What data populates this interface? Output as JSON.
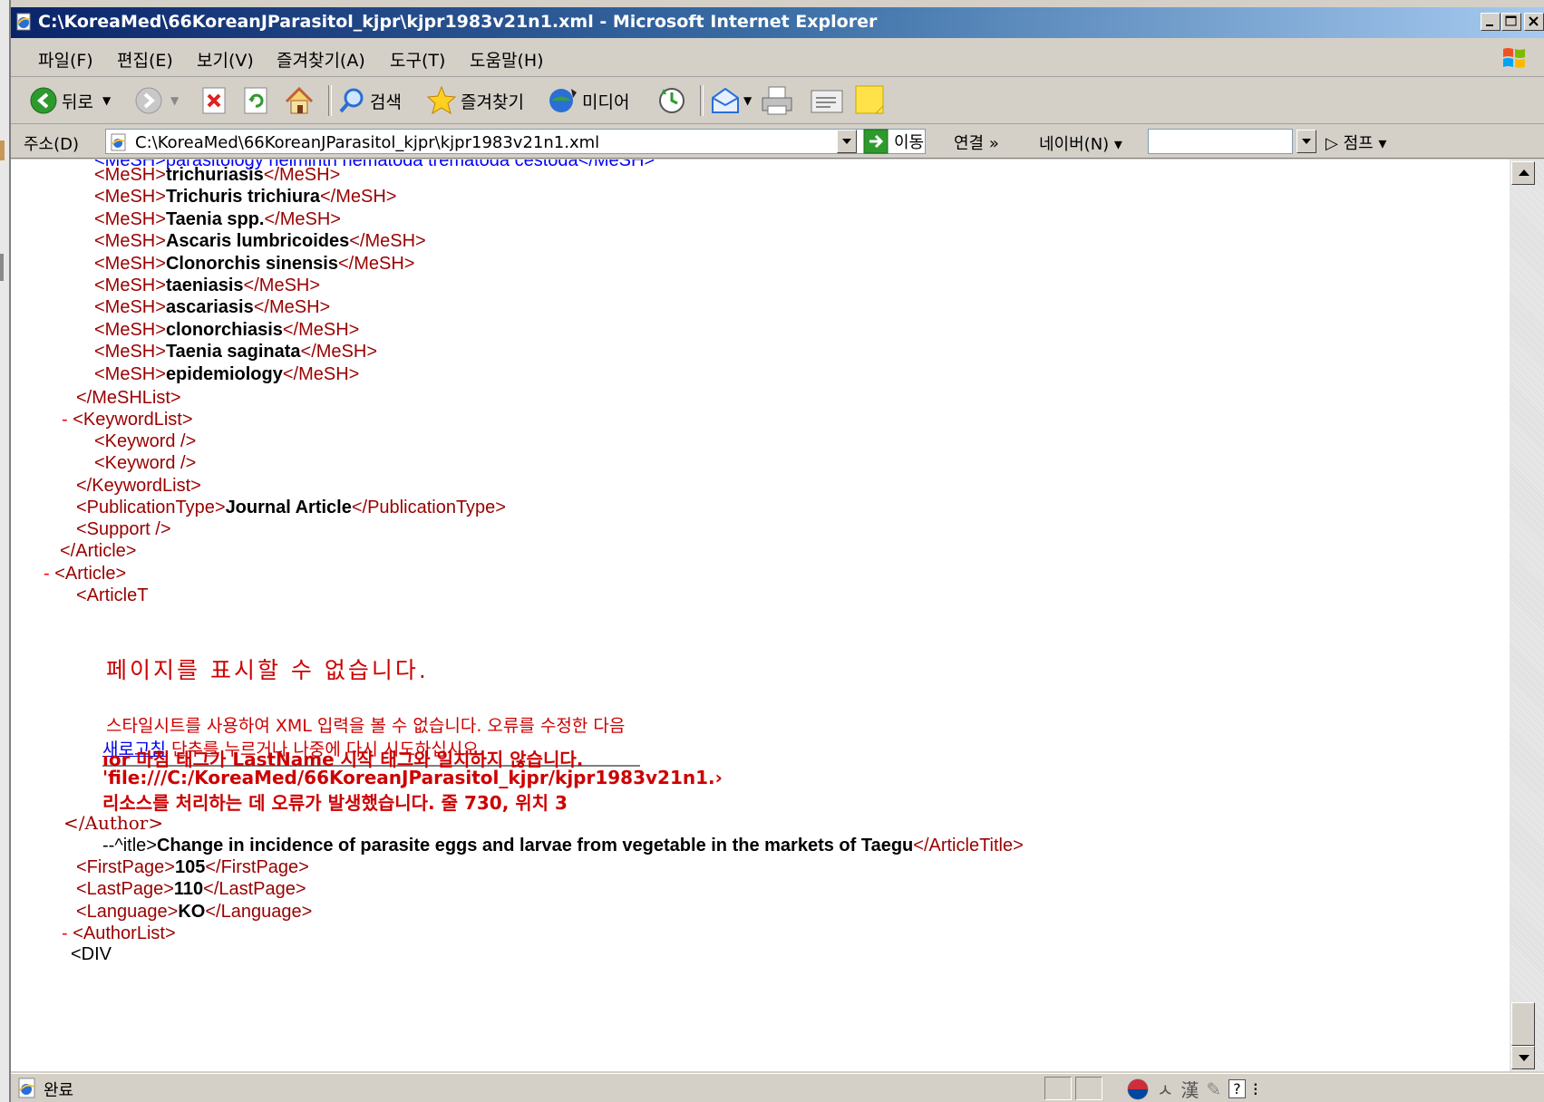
{
  "window": {
    "title": "C:\\KoreaMed\\66KoreanJParasitol_kjpr\\kjpr1983v21n1.xml - Microsoft Internet Explorer"
  },
  "menu": [
    "파일(F)",
    "편집(E)",
    "보기(V)",
    "즐겨찾기(A)",
    "도구(T)",
    "도움말(H)"
  ],
  "toolbar": {
    "back_label": "뒤로",
    "search_label": "검색",
    "favorites_label": "즐겨찾기",
    "media_label": "미디어"
  },
  "address": {
    "label": "주소(D)",
    "value": "C:\\KoreaMed\\66KoreanJParasitol_kjpr\\kjpr1983v21n1.xml",
    "go_label": "이동",
    "links_label": "연결 »",
    "naver_label": "네이버(N) ▾",
    "search_value": "",
    "jump_label": "점프 ▾"
  },
  "xml": {
    "top_partial": "<MeSH>parasitology helminth nematoda trematoda cestoda</MeSH>",
    "mesh_terms": [
      "trichuriasis",
      "Trichuris trichiura",
      "Taenia spp.",
      "Ascaris lumbricoides",
      "Clonorchis sinensis",
      "taeniasis",
      "ascariasis",
      "clonorchiasis",
      "Taenia saginata",
      "epidemiology"
    ],
    "mesh_open": "<MeSH>",
    "mesh_close": "</MeSH>",
    "meshlist_close": "</MeSHList>",
    "dash": "-",
    "keywordlist_open": "<KeywordList>",
    "keyword_1": "<Keyword />",
    "keyword_2": "<Keyword />",
    "keywordlist_close": "</KeywordList>",
    "pubtype_open": "<PublicationType>",
    "pubtype_value": "Journal Article",
    "pubtype_close": "</PublicationType>",
    "support": "<Support />",
    "article_close": "</Article>",
    "article_open": "<Article>",
    "articlet_partial": "<ArticleT",
    "title_prefix": "--^itle>",
    "article_title": "Change in incidence of parasite eggs and larvae from vegetable in the markets of Taegu",
    "article_title_close": "</ArticleTitle>",
    "firstpage_open": "<FirstPage>",
    "firstpage_value": "105",
    "firstpage_close": "</FirstPage>",
    "lastpage_open": "<LastPage>",
    "lastpage_value": "110",
    "lastpage_close": "</LastPage>",
    "language_open": "<Language>",
    "language_value": "KO",
    "language_close": "</Language>",
    "authorlist_open": "<AuthorList>",
    "div_partial": "<DIV"
  },
  "error": {
    "title": "페이지를 표시할 수 없습니다.",
    "desc_line1": "스타일시트를 사용하여 XML 입력을 볼 수 없습니다. 오류를 수정한 다음",
    "refresh_link": "새로고침",
    "desc_line2_rest": " 단추를 누르거나 나중에 다시 시도하십시오.",
    "detail_1": "ıor 마침 태그가 LastName 시작 태그와 일치하지 않습니다.",
    "detail_2": "'file:///C:/KoreaMed/66KoreanJParasitol_kjpr/kjpr1983v21n1.›",
    "detail_3": "리소스를 처리하는 데 오류가 발생했습니다. 줄 730, 위치 3",
    "author_close": "</Author>"
  },
  "status": {
    "text": "완료"
  },
  "colors": {
    "tag": "#990000",
    "bracket": "#0000ff",
    "error": "#cc0000",
    "chrome": "#d4d0c8",
    "titlebar": "#0a246a"
  }
}
